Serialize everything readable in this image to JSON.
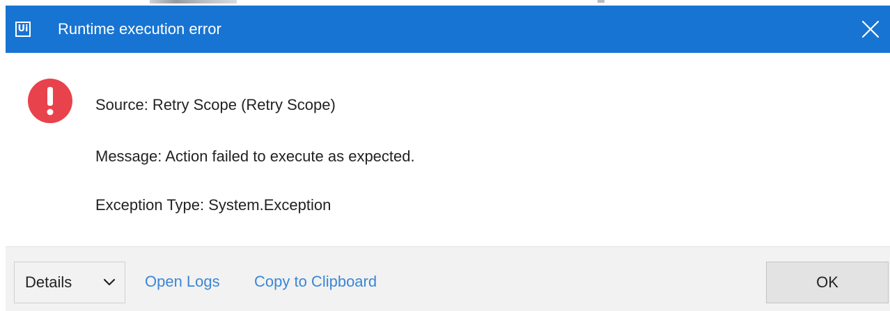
{
  "window": {
    "title": "Runtime execution error",
    "app_logo_text": "Ui",
    "title_bar_color": "#1874d2"
  },
  "icons": {
    "app_logo": "uipath-logo-icon",
    "close": "close-icon",
    "error": "error-exclamation-icon",
    "chevron": "chevron-down-icon"
  },
  "message": {
    "source": "Source: Retry Scope (Retry Scope)",
    "message": "Message: Action failed to execute as expected.",
    "exception_type": "Exception Type: System.Exception"
  },
  "footer": {
    "details_label": "Details",
    "open_logs_label": "Open Logs",
    "copy_clipboard_label": "Copy to Clipboard",
    "ok_label": "OK"
  },
  "colors": {
    "error_red": "#e8424d",
    "link_blue": "#3b86d6"
  }
}
